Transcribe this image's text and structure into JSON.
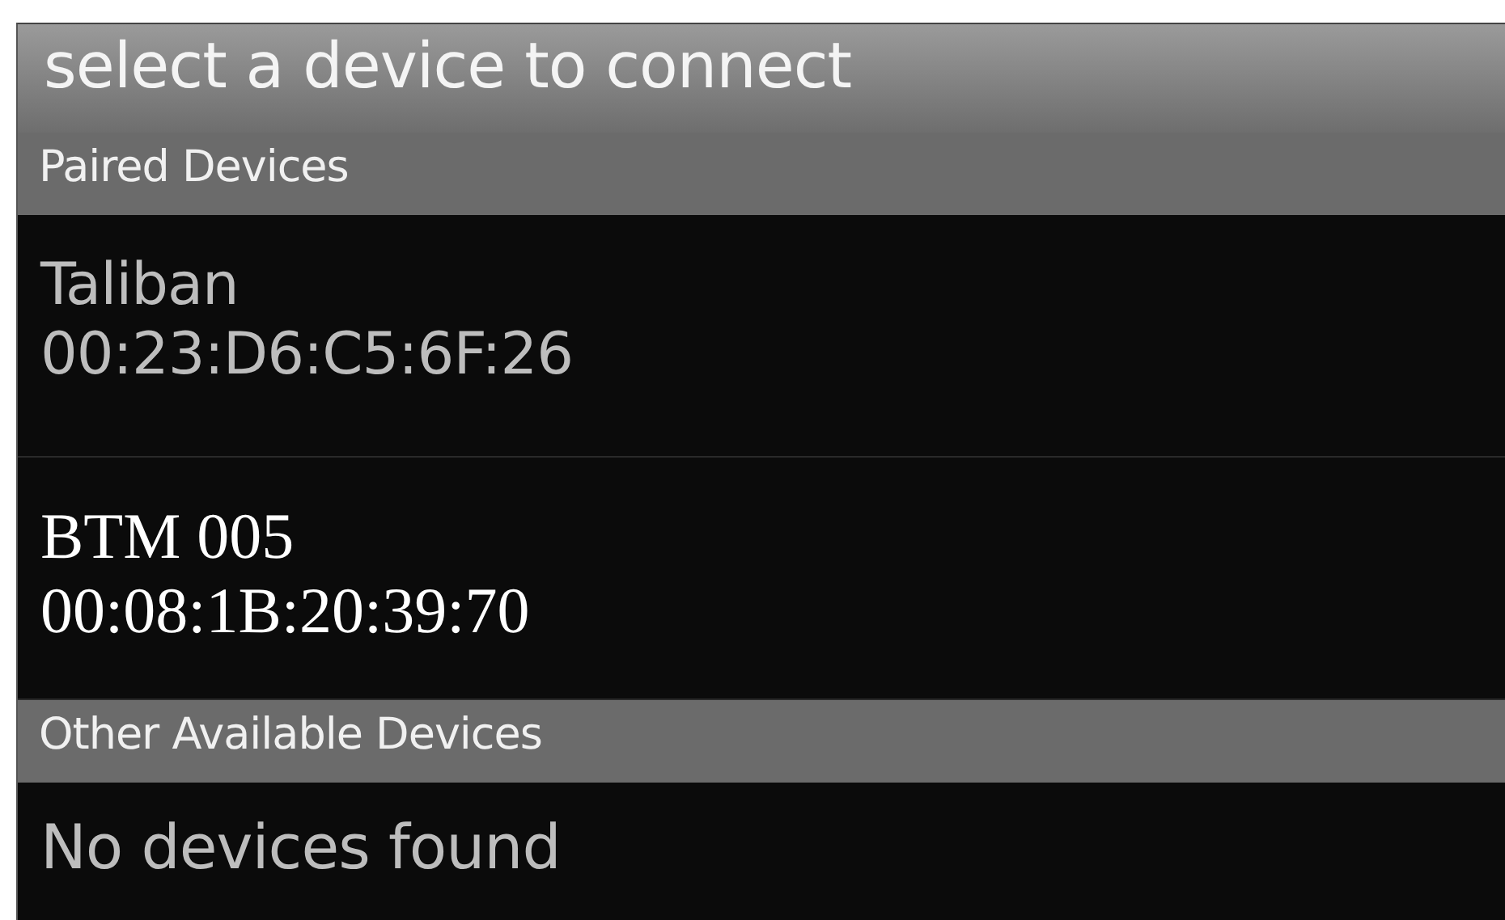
{
  "window": {
    "title": "select a device to connect"
  },
  "sections": [
    {
      "header": "Paired Devices",
      "devices": [
        {
          "kind": "plain",
          "name": "Taliban",
          "address": "00:23:D6:C5:6F:26"
        },
        {
          "kind": "serif",
          "name": "BTM 005",
          "address": "00:08:1B:20:39:70"
        }
      ]
    },
    {
      "header": "Other Available Devices",
      "empty_text": "No devices found"
    }
  ]
}
